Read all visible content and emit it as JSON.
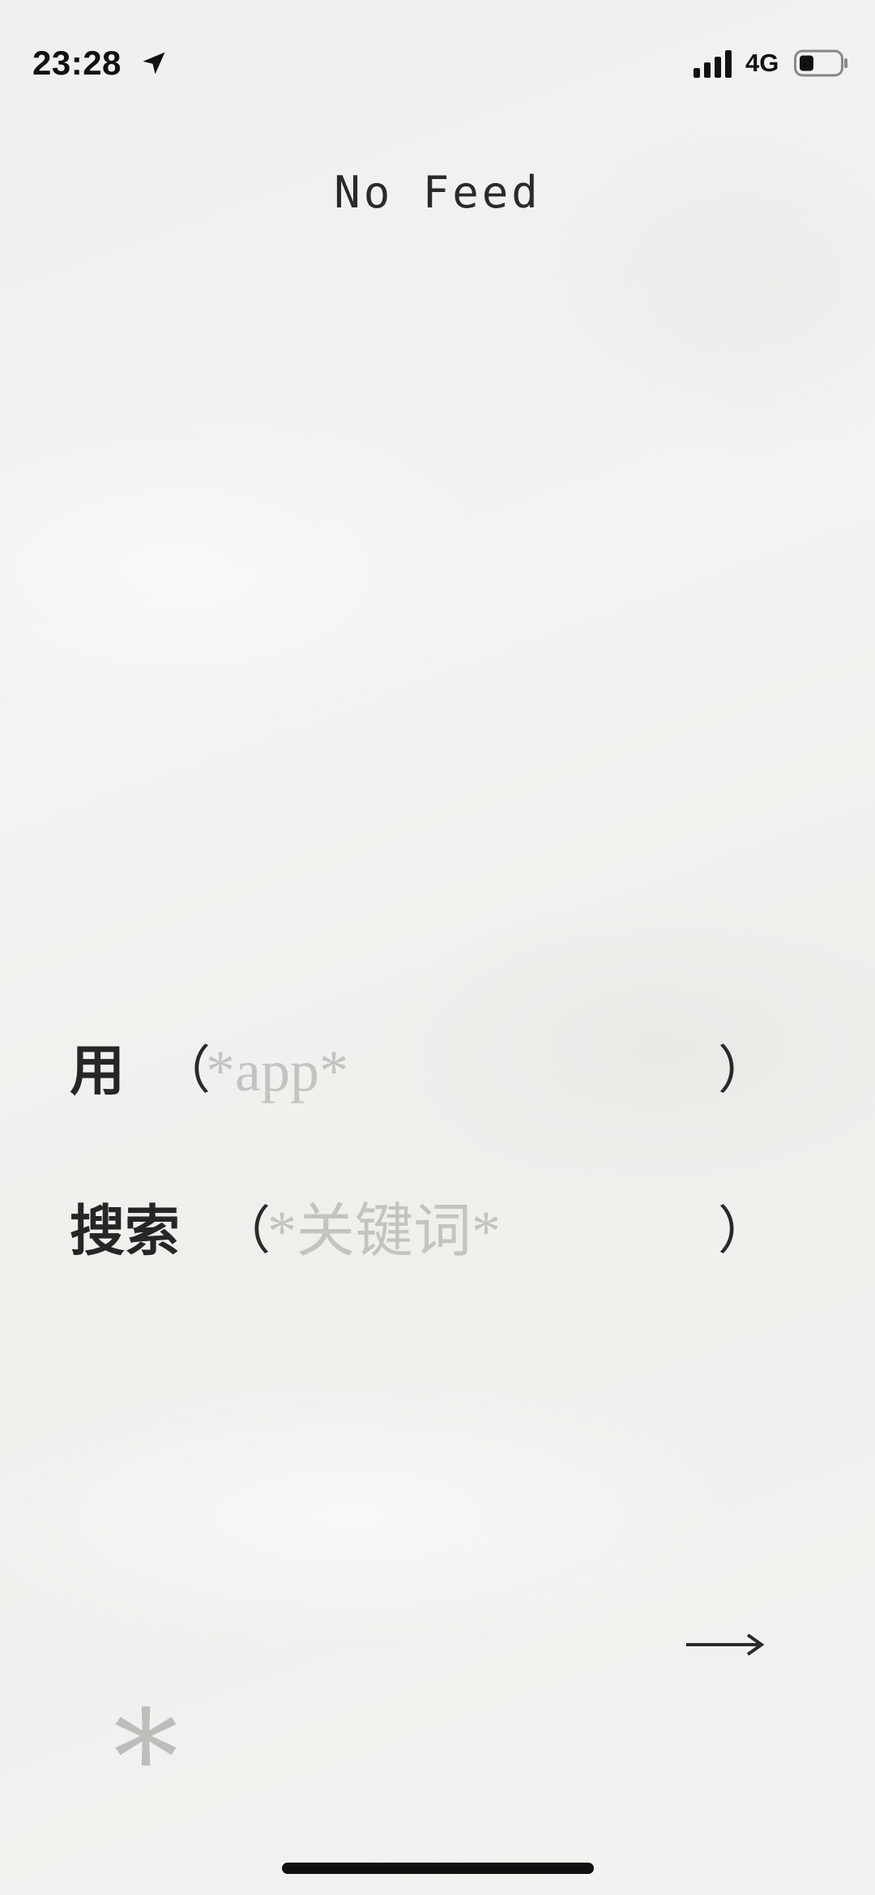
{
  "status_bar": {
    "time": "23:28",
    "network": "4G",
    "icons": [
      "location-arrow-icon",
      "signal-icon",
      "battery-icon"
    ]
  },
  "header": {
    "title": "No Feed"
  },
  "form": {
    "app_row": {
      "label": "用",
      "open_paren": "（",
      "placeholder": "*app*",
      "value": "",
      "close_paren": "）"
    },
    "search_row": {
      "label": "搜索",
      "open_paren": "（",
      "placeholder": "*关键词*",
      "value": "",
      "close_paren": "）"
    }
  },
  "controls": {
    "next_icon": "right-arrow-icon",
    "asterisk_symbol": "*"
  },
  "colors": {
    "background": "#f1f1ef",
    "text": "#262626",
    "placeholder": "#c3c3bf",
    "asterisk": "#bdbdb9"
  }
}
